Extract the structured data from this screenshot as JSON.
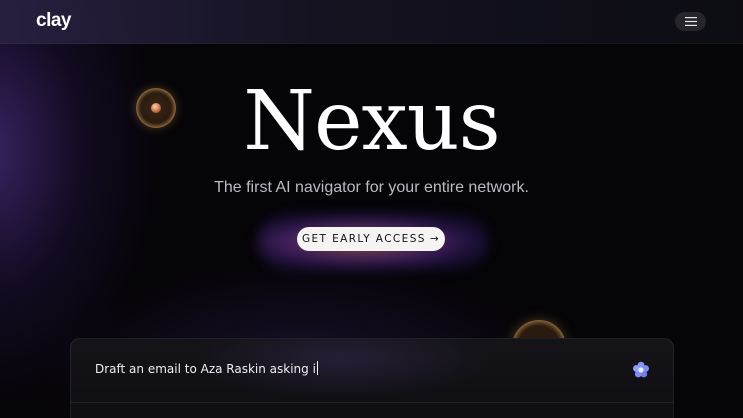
{
  "header": {
    "logo": "clay",
    "menu_icon": "hamburger-menu-icon"
  },
  "hero": {
    "title": "Nexus",
    "subtitle": "The first AI navigator for your entire network.",
    "cta_label": "GET EARLY ACCESS",
    "cta_arrow": "→"
  },
  "prompt": {
    "text": "Draft an email to Aza Raskin asking i",
    "icon": "flower-icon"
  },
  "colors": {
    "background": "#050407",
    "cta_background": "#f6f4f3",
    "accent_glow_orange": "#e68c3c",
    "accent_glow_purple": "#9646c8",
    "icon_blue": "#7b8cf5"
  }
}
